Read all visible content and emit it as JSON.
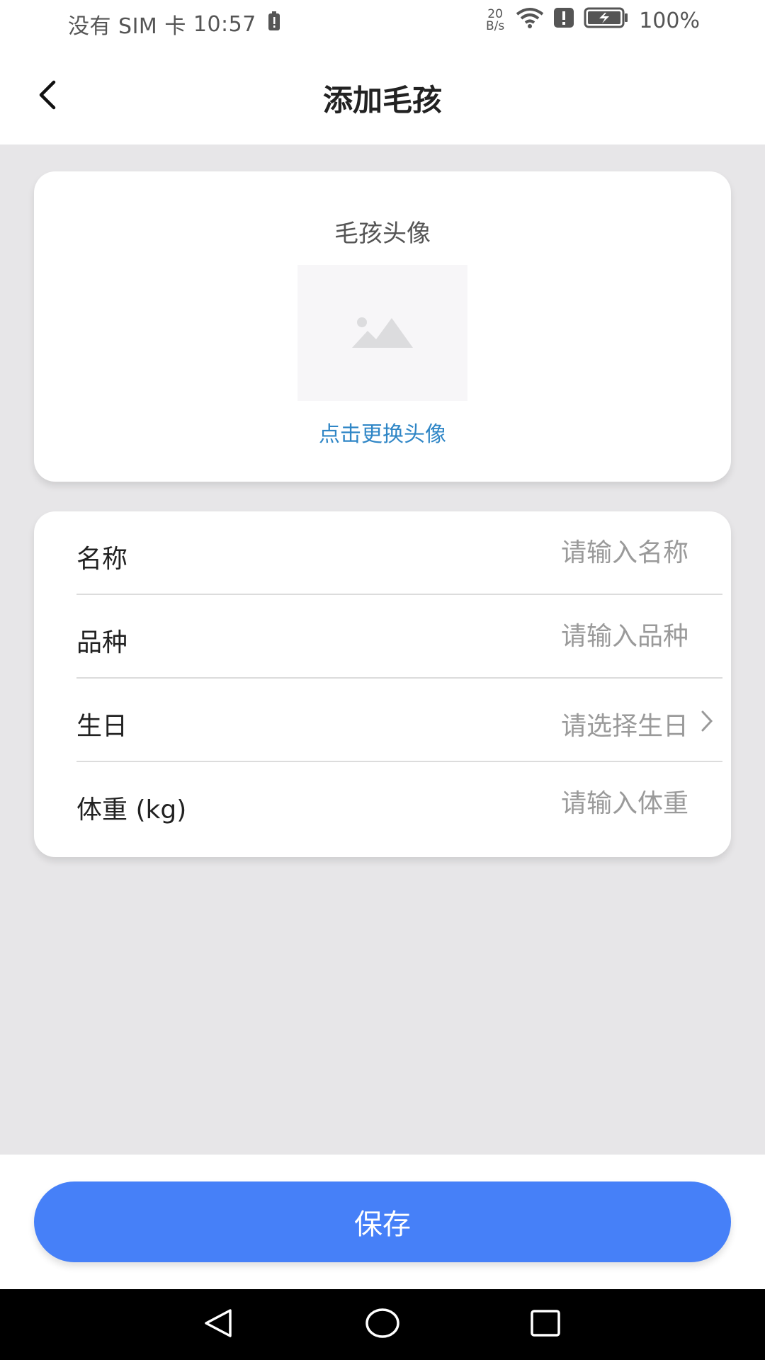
{
  "status_bar": {
    "carrier": "没有 SIM 卡",
    "time": "10:57",
    "net_speed_value": "20",
    "net_speed_unit": "B/s",
    "battery": "100%",
    "icons": [
      "sim-alert-icon",
      "wifi-icon",
      "alert-icon",
      "battery-charging-icon"
    ]
  },
  "header": {
    "title": "添加毛孩",
    "back_icon": "back-arrow-icon"
  },
  "avatar_card": {
    "title": "毛孩头像",
    "placeholder_icon": "image-placeholder-icon",
    "change_label": "点击更换头像"
  },
  "form": {
    "name": {
      "label": "名称",
      "placeholder": "请输入名称"
    },
    "breed": {
      "label": "品种",
      "placeholder": "请输入品种"
    },
    "birthday": {
      "label": "生日",
      "placeholder": "请选择生日",
      "icon": "chevron-right-icon"
    },
    "weight": {
      "label": "体重 (kg)",
      "placeholder": "请输入体重"
    }
  },
  "save_button": {
    "label": "保存"
  },
  "colors": {
    "accent": "#4680f8",
    "link": "#2f86c6",
    "background": "#e7e6e8",
    "placeholder": "#9a9a9a"
  },
  "nav_bar": {
    "icons": [
      "back-triangle-icon",
      "home-circle-icon",
      "recents-square-icon"
    ]
  }
}
